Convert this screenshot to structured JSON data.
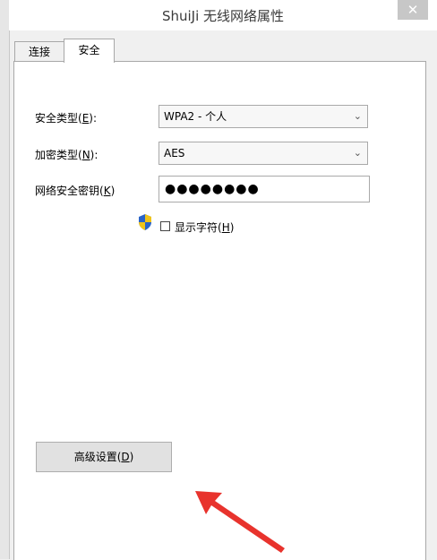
{
  "window": {
    "title": "ShuiJi 无线网络属性",
    "close_label": "✕"
  },
  "tabs": [
    {
      "label": "连接",
      "selected": false
    },
    {
      "label": "安全",
      "selected": true
    }
  ],
  "security_type": {
    "label": "安全类型(",
    "mnemonic": "E",
    "suffix": "):",
    "value": "WPA2 - 个人"
  },
  "encryption_type": {
    "label": "加密类型(",
    "mnemonic": "N",
    "suffix": "):",
    "value": "AES"
  },
  "network_key": {
    "label": "网络安全密钥(",
    "mnemonic": "K",
    "suffix": ")",
    "value": "●●●●●●●●"
  },
  "show_chars": {
    "label": "显示字符(",
    "mnemonic": "H",
    "suffix": ")",
    "checked": false
  },
  "advanced": {
    "label": "高级设置(",
    "mnemonic": "D",
    "suffix": ")"
  },
  "colors": {
    "accent_arrow": "#e8332d",
    "shield_blue": "#2a64c8",
    "shield_yellow": "#f0c419"
  },
  "icons": {
    "shield": "uac-shield-icon",
    "chevron": "chevron-down-icon",
    "arrow": "annotation-arrow-icon"
  }
}
